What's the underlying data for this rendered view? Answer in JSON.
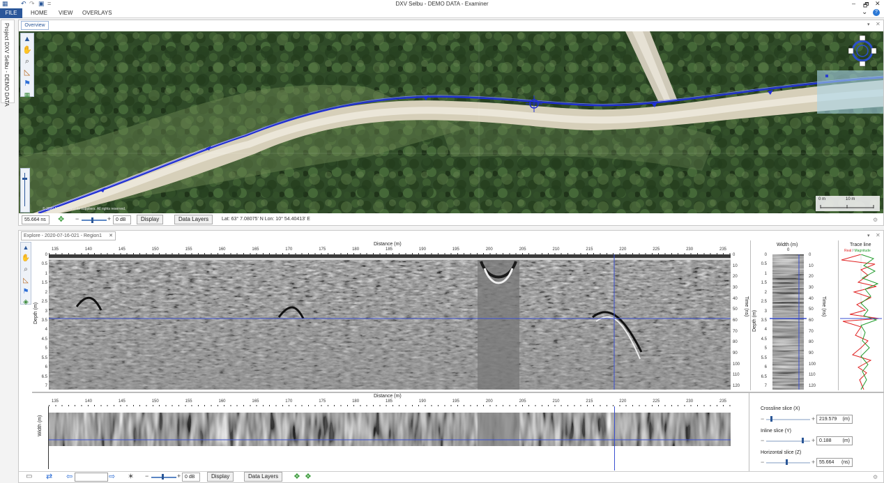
{
  "titlebar": {
    "title": "DXV Selbu - DEMO DATA - Examiner",
    "undo_icon": "undo-icon",
    "redo_icon": "redo-icon",
    "save_icon": "save-icon",
    "minimize": "–",
    "restore": "🗗",
    "close": "✕"
  },
  "ribbon": {
    "file": "FILE",
    "tabs": [
      "HOME",
      "VIEW",
      "OVERLAYS"
    ],
    "collapse": "⌄",
    "help": "?"
  },
  "sidetab": {
    "label": "Project DXV Selbu - DEMO DATA"
  },
  "overview": {
    "tab_label": "Overview",
    "copyright": "© 2020 Microsoft and its suppliers. All rights reserved.",
    "compass_labels": [
      "N",
      "W",
      "E",
      "S"
    ],
    "scale_labels": [
      "0 m",
      "10 m"
    ],
    "status": {
      "time": "55.664 ns",
      "gain": "0 dB",
      "gain_minus": "−",
      "gain_plus": "+",
      "display": "Display",
      "data_layers": "Data Layers",
      "coords": "Lat: 63° 7.08075' N Lon: 10° 54.40413' E"
    }
  },
  "explore": {
    "tab_label": "Explore - 2020-07-16-021 - Region1",
    "tab_close": "✕",
    "radargram": {
      "title_x": "Distance (m)",
      "ylabel_left": "Depth (m)",
      "ylabel_right": "Time (ns)",
      "distance_ticks": [
        "135",
        "140",
        "145",
        "150",
        "155",
        "160",
        "165",
        "170",
        "175",
        "180",
        "185",
        "190",
        "195",
        "200",
        "205",
        "210",
        "215",
        "220",
        "225",
        "230",
        "235"
      ],
      "depth_ticks": [
        "0",
        "0.5",
        "1",
        "1.5",
        "2",
        "2.5",
        "3",
        "3.5",
        "4",
        "4.5",
        "5",
        "5.5",
        "6",
        "6.5",
        "7"
      ],
      "time_ticks": [
        "0",
        "10",
        "20",
        "30",
        "40",
        "50",
        "60",
        "70",
        "80",
        "90",
        "100",
        "110",
        "120"
      ]
    },
    "width_panel": {
      "title": "Width (m)",
      "zero": "0",
      "ylabel_left": "Depth (m)",
      "ylabel_right": "Time (ns)"
    },
    "trace_panel": {
      "title": "Trace line",
      "legend_real": "Real",
      "legend_sep": " / ",
      "legend_mag": "Magnitude"
    },
    "slice_view": {
      "title_x": "Distance (m)",
      "ylabel": "Width (m)",
      "distance_ticks": [
        "135",
        "140",
        "145",
        "150",
        "155",
        "160",
        "165",
        "170",
        "175",
        "180",
        "185",
        "190",
        "195",
        "200",
        "205",
        "210",
        "215",
        "220",
        "225",
        "230",
        "235"
      ]
    },
    "slices": {
      "crossline_label": "Crossline slice (X)",
      "crossline_value": "219.579",
      "crossline_unit": "(m)",
      "inline_label": "Inline slice (Y)",
      "inline_value": "0.188",
      "inline_unit": "(m)",
      "horizontal_label": "Horizontal slice (Z)",
      "horizontal_value": "55.664",
      "horizontal_unit": "(ns)",
      "crossline_fraction": 0.1,
      "inline_fraction": 0.85,
      "horizontal_fraction": 0.47
    },
    "status": {
      "gain": "0 dB",
      "gain_minus": "−",
      "gain_plus": "+",
      "display": "Display",
      "data_layers": "Data Layers"
    }
  },
  "colors": {
    "accent": "#2b579a",
    "track": "#1f2fd6",
    "cursor": "#3a4fd0",
    "real": "#e02020",
    "magnitude": "#1f9a2a"
  }
}
